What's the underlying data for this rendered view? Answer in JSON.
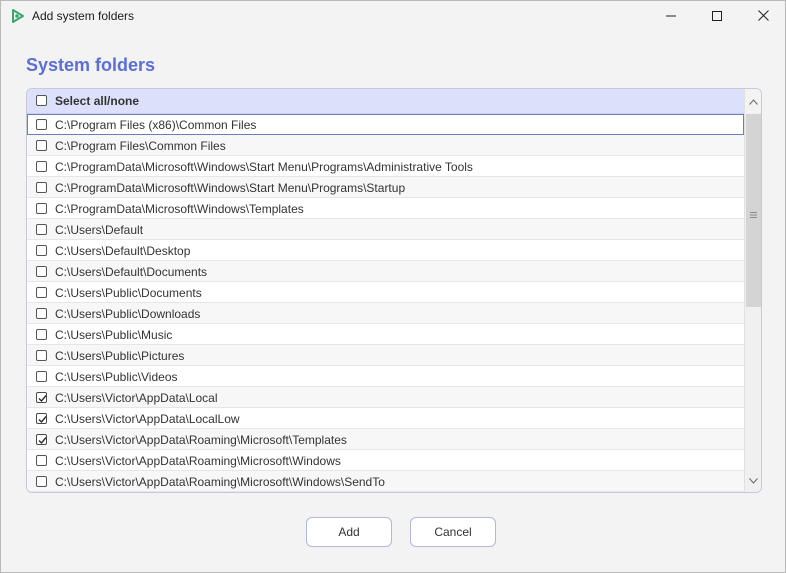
{
  "window": {
    "title": "Add system folders"
  },
  "heading": "System folders",
  "list": {
    "select_all_label": "Select all/none",
    "select_all_checked": false,
    "items": [
      {
        "label": "C:\\Program Files (x86)\\Common Files",
        "checked": false,
        "focused": true
      },
      {
        "label": "C:\\Program Files\\Common Files",
        "checked": false
      },
      {
        "label": "C:\\ProgramData\\Microsoft\\Windows\\Start Menu\\Programs\\Administrative Tools",
        "checked": false
      },
      {
        "label": "C:\\ProgramData\\Microsoft\\Windows\\Start Menu\\Programs\\Startup",
        "checked": false
      },
      {
        "label": "C:\\ProgramData\\Microsoft\\Windows\\Templates",
        "checked": false
      },
      {
        "label": "C:\\Users\\Default",
        "checked": false
      },
      {
        "label": "C:\\Users\\Default\\Desktop",
        "checked": false
      },
      {
        "label": "C:\\Users\\Default\\Documents",
        "checked": false
      },
      {
        "label": "C:\\Users\\Public\\Documents",
        "checked": false
      },
      {
        "label": "C:\\Users\\Public\\Downloads",
        "checked": false
      },
      {
        "label": "C:\\Users\\Public\\Music",
        "checked": false
      },
      {
        "label": "C:\\Users\\Public\\Pictures",
        "checked": false
      },
      {
        "label": "C:\\Users\\Public\\Videos",
        "checked": false
      },
      {
        "label": "C:\\Users\\Victor\\AppData\\Local",
        "checked": true
      },
      {
        "label": "C:\\Users\\Victor\\AppData\\LocalLow",
        "checked": true
      },
      {
        "label": "C:\\Users\\Victor\\AppData\\Roaming\\Microsoft\\Templates",
        "checked": true
      },
      {
        "label": "C:\\Users\\Victor\\AppData\\Roaming\\Microsoft\\Windows",
        "checked": false
      },
      {
        "label": "C:\\Users\\Victor\\AppData\\Roaming\\Microsoft\\Windows\\SendTo",
        "checked": false
      }
    ]
  },
  "buttons": {
    "add": "Add",
    "cancel": "Cancel"
  },
  "colors": {
    "accent": "#5b6fd6",
    "header_bg": "#dde0fb",
    "app_icon": "#3aa76d"
  },
  "icons": {
    "app": "app-logo-icon",
    "minimize": "minimize-icon",
    "maximize": "maximize-icon",
    "close": "close-icon",
    "scroll_up": "chevron-up-icon",
    "scroll_down": "chevron-down-icon",
    "grip": "scroll-grip-icon",
    "check": "check-icon"
  }
}
